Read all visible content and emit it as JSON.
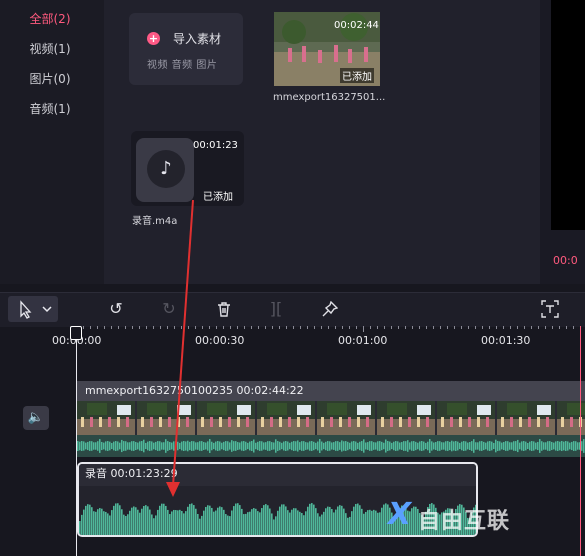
{
  "sidebar": {
    "items": [
      {
        "label": "全部(2)",
        "active": true
      },
      {
        "label": "视频(1)",
        "active": false
      },
      {
        "label": "图片(0)",
        "active": false
      },
      {
        "label": "音频(1)",
        "active": false
      }
    ]
  },
  "media": {
    "import_title": "导入素材",
    "import_sub": "视频  音频  图片",
    "video_item": {
      "duration": "00:02:44",
      "status": "已添加",
      "filename": "mmexport16327501..."
    },
    "audio_item": {
      "duration": "00:01:23",
      "status": "已添加",
      "filename": "录音.m4a",
      "icon": "music-note-icon"
    }
  },
  "preview": {
    "time": "00:0"
  },
  "toolbar": {
    "tools": [
      "select-cursor-icon",
      "undo-icon",
      "redo-icon",
      "delete-icon",
      "split-icon",
      "pin-icon",
      "text-recognize-icon"
    ]
  },
  "ruler": {
    "labels": [
      "00:00:00",
      "00:00:30",
      "00:01:00",
      "00:01:30"
    ]
  },
  "timeline": {
    "video_track_title": "mmexport1632750100235    00:02:44:22",
    "audio_track_title": "录音     00:01:23:29"
  },
  "watermark": {
    "mark": "X",
    "text": "自由互联"
  },
  "colors": {
    "accent": "#ff5a7e",
    "waveform": "#4fb89a",
    "background": "#17171f"
  }
}
